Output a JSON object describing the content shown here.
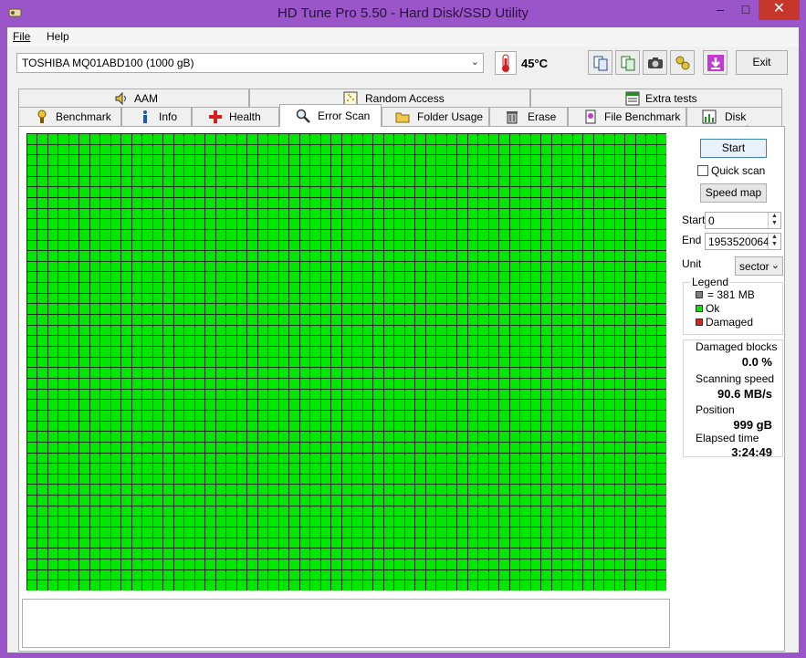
{
  "window": {
    "title": "HD Tune Pro 5.50 - Hard Disk/SSD Utility",
    "minimize": "–",
    "maximize": "□",
    "close": "✕"
  },
  "menu": {
    "file": "File",
    "help": "Help"
  },
  "toolbar": {
    "drive": "TOSHIBA MQ01ABD100 (1000 gB)",
    "temperature": "45°C",
    "buttons": [
      "copy-info-icon",
      "copy-all-icon",
      "screenshot-icon",
      "options-icon",
      "save-icon"
    ],
    "exit_label": "Exit"
  },
  "tabs_row1": [
    {
      "label": "AAM",
      "icon": "speaker-icon"
    },
    {
      "label": "Random Access",
      "icon": "random-access-icon"
    },
    {
      "label": "Extra tests",
      "icon": "extra-tests-icon"
    }
  ],
  "tabs_row2": [
    {
      "label": "Benchmark",
      "icon": "benchmark-icon"
    },
    {
      "label": "Info",
      "icon": "info-icon"
    },
    {
      "label": "Health",
      "icon": "health-icon"
    },
    {
      "label": "Error Scan",
      "icon": "magnifier-icon",
      "active": true
    },
    {
      "label": "Folder Usage",
      "icon": "folder-icon"
    },
    {
      "label": "Erase",
      "icon": "trash-icon"
    },
    {
      "label": "File Benchmark",
      "icon": "file-benchmark-icon"
    },
    {
      "label": "Disk monitor",
      "icon": "disk-monitor-icon"
    }
  ],
  "scan": {
    "grid_cols": 61,
    "grid_rows": 43,
    "block_state": "ok",
    "colors": {
      "ok": "#00e800",
      "damaged": "#e02020",
      "untested": "#808080",
      "gridline": "#0f2d0f"
    }
  },
  "controls": {
    "start_label": "Start",
    "quick_scan_label": "Quick scan",
    "speed_map_label": "Speed map",
    "start_field_label": "Start",
    "start_value": "0",
    "end_field_label": "End",
    "end_value": "1953520064",
    "unit_label": "Unit",
    "unit_value": "sector"
  },
  "legend": {
    "title": "Legend",
    "block_size": "= 381 MB",
    "ok": "Ok",
    "damaged": "Damaged"
  },
  "stats": {
    "damaged_blocks_label": "Damaged blocks",
    "damaged_blocks_value": "0.0 %",
    "scanning_speed_label": "Scanning speed",
    "scanning_speed_value": "90.6 MB/s",
    "position_label": "Position",
    "position_value": "999 gB",
    "elapsed_time_label": "Elapsed time",
    "elapsed_time_value": "3:24:49"
  }
}
